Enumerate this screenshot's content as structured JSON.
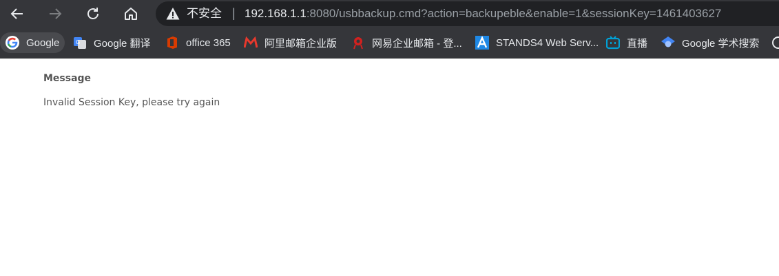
{
  "browser": {
    "security_label": "不安全",
    "separator": "|",
    "url_host": "192.168.1.1",
    "url_rest": ":8080/usbbackup.cmd?action=backupeble&enable=1&sessionKey=1461403627",
    "nav_icons": [
      "back-arrow-icon",
      "forward-arrow-icon",
      "reload-icon",
      "home-icon"
    ],
    "colors": {
      "toolbar": "#35363a",
      "omnibox": "#202124",
      "text": "#e8eaed",
      "url_dim": "#9aa0a6"
    }
  },
  "bookmarks": [
    {
      "label": "Google",
      "icon": "google-g-icon"
    },
    {
      "label": "Google 翻译",
      "icon": "google-translate-icon"
    },
    {
      "label": "office 365",
      "icon": "office-icon"
    },
    {
      "label": "阿里邮箱企业版",
      "icon": "ali-mail-icon"
    },
    {
      "label": "网易企业邮箱 - 登...",
      "icon": "netease-mail-icon"
    },
    {
      "label": "STANDS4 Web Serv...",
      "icon": "stands4-icon"
    },
    {
      "label": "直播",
      "icon": "bilibili-tv-icon"
    },
    {
      "label": "Google 学术搜索",
      "icon": "scholar-icon"
    }
  ],
  "page": {
    "title": "Message",
    "body": "Invalid Session Key, please try again"
  }
}
